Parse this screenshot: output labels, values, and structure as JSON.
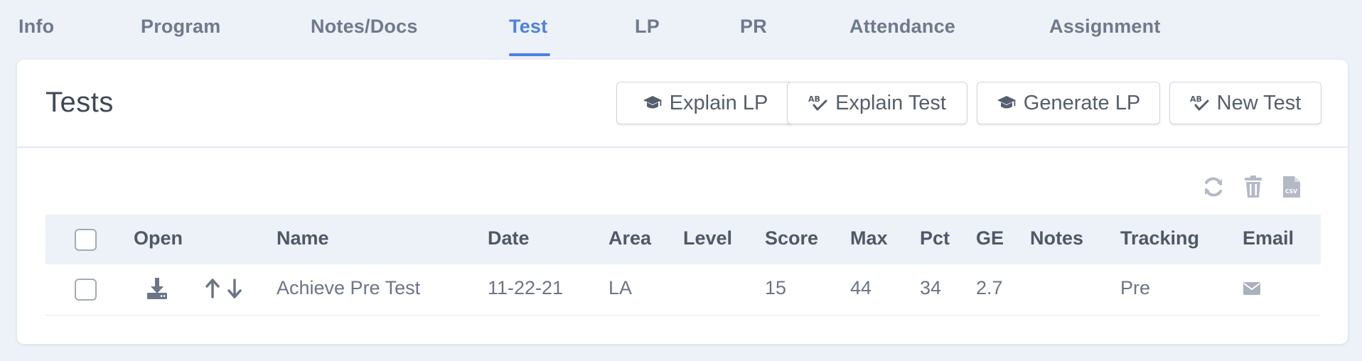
{
  "tabs": [
    {
      "label": "Info"
    },
    {
      "label": "Program"
    },
    {
      "label": "Notes/Docs"
    },
    {
      "label": "Test",
      "active": true
    },
    {
      "label": "LP"
    },
    {
      "label": "PR"
    },
    {
      "label": "Attendance"
    },
    {
      "label": "Assignment"
    }
  ],
  "card": {
    "title": "Tests",
    "buttons": {
      "explain_lp": "Explain LP",
      "explain_test": "Explain Test",
      "generate_lp": "Generate LP",
      "new_test": "New Test"
    },
    "toolbar_icons": [
      "refresh-icon",
      "trash-icon",
      "csv-file-icon"
    ]
  },
  "table": {
    "headers": {
      "open": "Open",
      "name": "Name",
      "date": "Date",
      "area": "Area",
      "level": "Level",
      "score": "Score",
      "max": "Max",
      "pct": "Pct",
      "ge": "GE",
      "notes": "Notes",
      "tracking": "Tracking",
      "email": "Email"
    },
    "rows": [
      {
        "name": "Achieve Pre Test",
        "date": "11-22-21",
        "area": "LA",
        "level": "",
        "score": "15",
        "max": "44",
        "pct": "34",
        "ge": "2.7",
        "notes": "",
        "tracking": "Pre"
      }
    ]
  },
  "colors": {
    "accent": "#4e80e3",
    "background": "#edf1f8",
    "text": "#6b7587",
    "heading": "#4f5868"
  }
}
